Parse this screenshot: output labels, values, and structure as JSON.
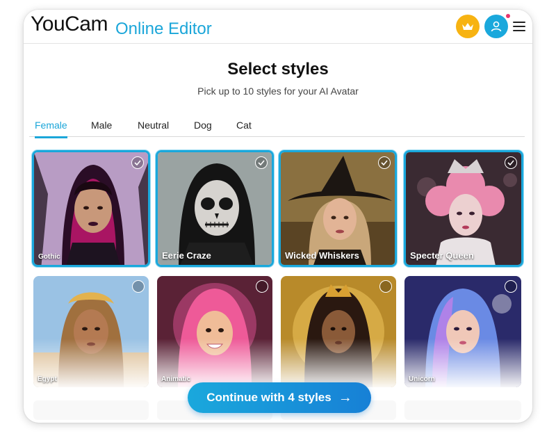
{
  "header": {
    "logo_text": "YouCam",
    "logo_subtext": "Online Editor",
    "icons": {
      "premium": "crown-icon",
      "account": "user-icon",
      "menu": "hamburger-menu-icon"
    },
    "colors": {
      "brand": "#1ba6d9",
      "premium": "#f7b312",
      "notification": "#e8356d"
    }
  },
  "page": {
    "title": "Select styles",
    "subtitle": "Pick up to 10 styles for your AI Avatar"
  },
  "tabs": [
    {
      "label": "Female",
      "active": true
    },
    {
      "label": "Male",
      "active": false
    },
    {
      "label": "Neutral",
      "active": false
    },
    {
      "label": "Dog",
      "active": false
    },
    {
      "label": "Cat",
      "active": false
    }
  ],
  "styles": [
    {
      "label": "Gothic",
      "selected": true
    },
    {
      "label": "Eerie Craze",
      "selected": true
    },
    {
      "label": "Wicked Whiskers",
      "selected": true
    },
    {
      "label": "Specter Queen",
      "selected": true
    },
    {
      "label": "Egypt",
      "selected": false
    },
    {
      "label": "Animatic",
      "selected": false
    },
    {
      "label": "",
      "selected": false
    },
    {
      "label": "Unicorn",
      "selected": false
    }
  ],
  "continue_button": {
    "label": "Continue with 4 styles",
    "icon": "arrow-right-icon"
  }
}
